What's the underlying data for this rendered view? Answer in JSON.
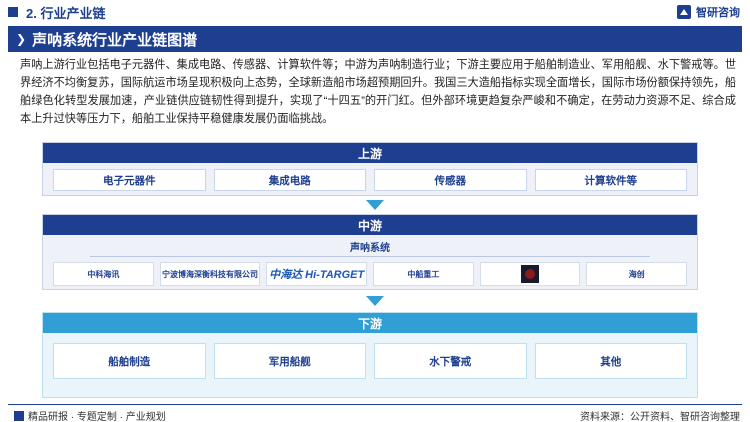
{
  "header": {
    "section_title": "2. 行业产业链",
    "brand_name": "智研咨询"
  },
  "page_title": "声呐系统行业产业链图谱",
  "intro": "声呐上游行业包括电子元器件、集成电路、传感器、计算软件等；中游为声呐制造行业；下游主要应用于船舶制造业、军用船舰、水下警戒等。世界经济不均衡复苏，国际航运市场呈现积极向上态势，全球新造船市场超预期回升。我国三大造船指标实现全面增长，国际市场份额保持领先，船舶绿色化转型发展加速，产业链供应链韧性得到提升，实现了“十四五”的开门红。但外部环境更趋复杂严峻和不确定，在劳动力资源不足、综合成本上升过快等压力下，船舶工业保持平稳健康发展仍面临挑战。",
  "upstream": {
    "title": "上游",
    "items": [
      "电子元器件",
      "集成电路",
      "传感器",
      "计算软件等"
    ]
  },
  "midstream": {
    "title": "中游",
    "subtitle": "声呐系统",
    "companies": [
      "中科海讯",
      "宁波博海深衡科技有限公司",
      "中海达 Hi-TARGET",
      "中船重工",
      "",
      "海创"
    ]
  },
  "downstream": {
    "title": "下游",
    "items": [
      "船舶制造",
      "军用船舰",
      "水下警戒",
      "其他"
    ]
  },
  "footer": {
    "left": "精品研报 · 专题定制 · 产业规划",
    "right": "资料来源：公开资料、智研咨询整理"
  },
  "colors": {
    "primary": "#1e3f8f",
    "accent": "#2f9fd6"
  }
}
